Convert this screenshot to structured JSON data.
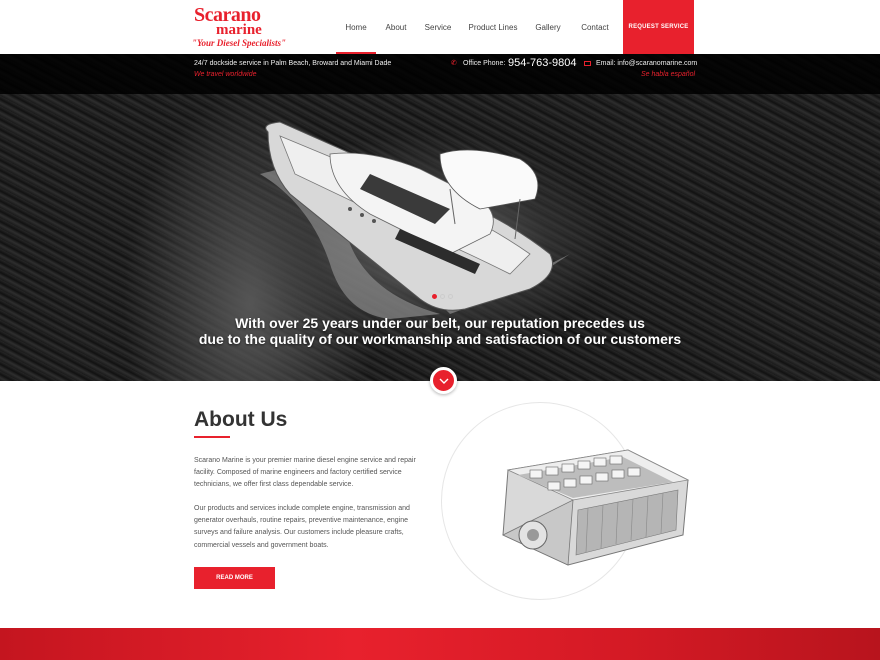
{
  "logo": {
    "line1": "Scarano",
    "line2": "marine",
    "tagline": "\"Your Diesel Specialists\""
  },
  "nav": {
    "items": [
      {
        "label": "Home",
        "active": true
      },
      {
        "label": "About",
        "active": false
      },
      {
        "label": "Service",
        "active": false
      },
      {
        "label": "Product Lines",
        "active": false
      },
      {
        "label": "Gallery",
        "active": false
      },
      {
        "label": "Contact",
        "active": false
      }
    ],
    "cta_label": "REQUEST SERVICE"
  },
  "topbar": {
    "service_area": "24/7 dockside service in Palm Beach, Broward and Miami Dade",
    "travel": "We travel worldwide",
    "phone_label": "Office Phone:",
    "phone_number": "954-763-9804",
    "email": "Email: info@scaranomarine.com",
    "spanish": "Se habla español"
  },
  "hero": {
    "line1": "With over 25 years under our belt, our reputation precedes us",
    "line2": "due to the quality of our workmanship and satisfaction of our customers",
    "slides": 3,
    "active_slide": 1
  },
  "about": {
    "title": "About Us",
    "paragraph1": "Scarano Marine is your premier marine diesel engine service and repair facility. Composed of marine engineers and factory certified service technicians, we offer first class dependable service.",
    "paragraph2": "Our products and services include complete engine, transmission and generator overhauls, routine repairs, preventive maintenance, engine surveys and failure analysis. Our customers include pleasure crafts, commercial vessels and government boats.",
    "button_label": "READ MORE"
  },
  "colors": {
    "accent": "#e8212d",
    "dark": "#1b1b1b",
    "text": "#333333"
  },
  "icons": [
    "phone-icon",
    "mail-icon",
    "chevron-down-icon"
  ]
}
